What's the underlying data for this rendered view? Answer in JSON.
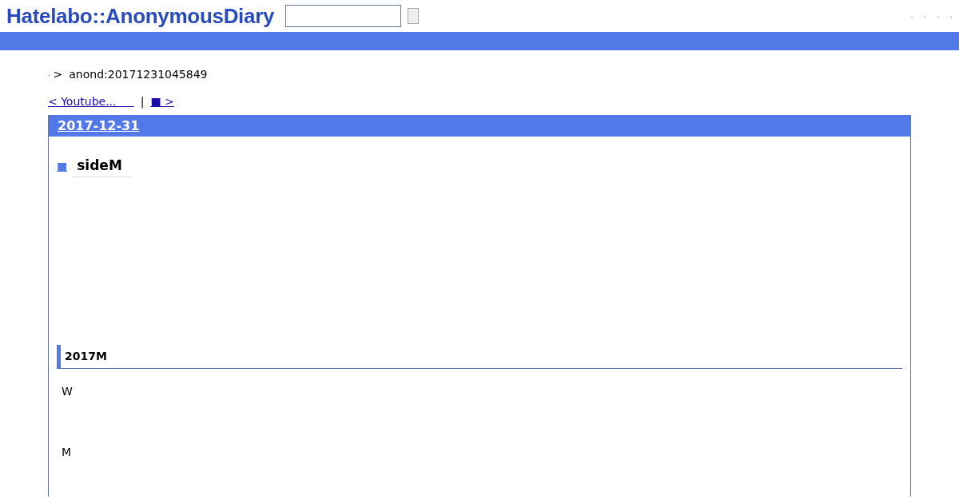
{
  "header": {
    "logo": "Hatelabo::AnonymousDiary",
    "links": [
      ".",
      ".",
      ".",
      "."
    ]
  },
  "breadcrumb": {
    "home": ".",
    "separator": ">",
    "current": "anond:20171231045849"
  },
  "pager": {
    "prev": "< Youtube...",
    "separator": "|",
    "next_mark": "■",
    "next": ">"
  },
  "day": {
    "date": "2017-12-31",
    "entry": {
      "mark": "■",
      "title": "sideM"
    },
    "section": {
      "title": "2017M",
      "paragraphs": [
        "W",
        "M"
      ]
    }
  }
}
